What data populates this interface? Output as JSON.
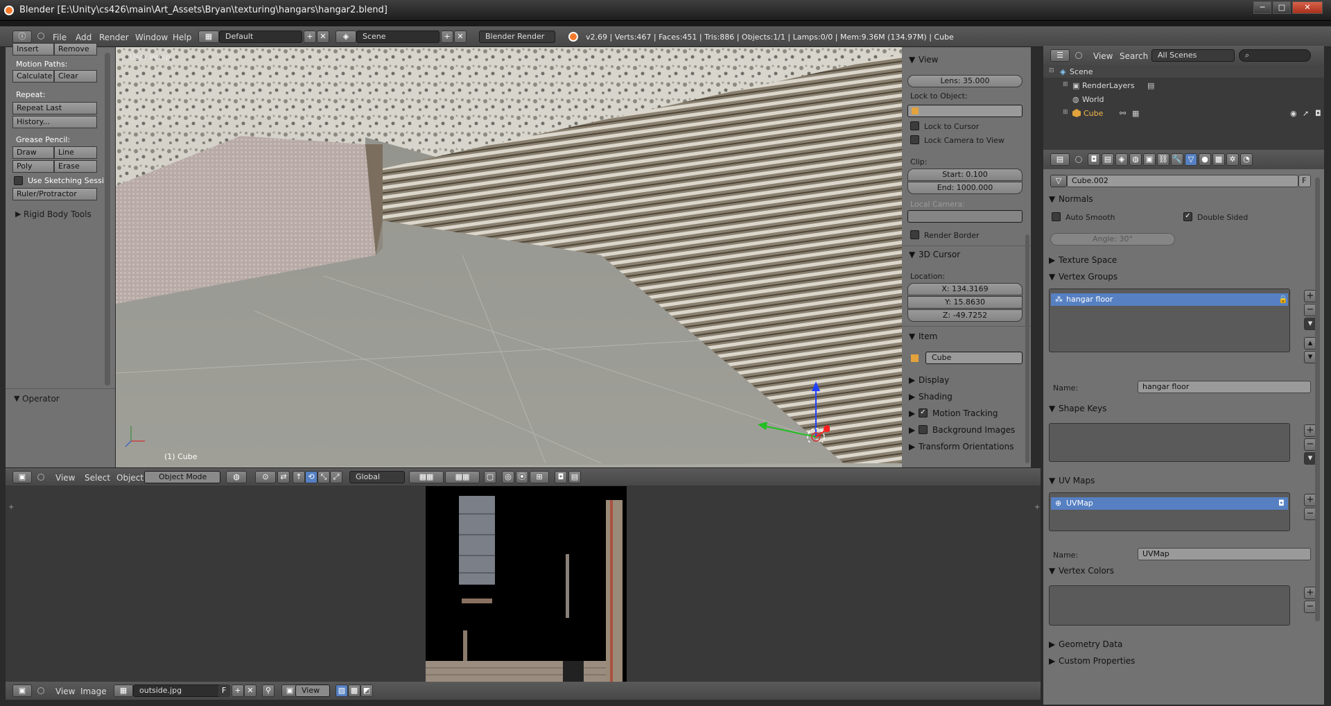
{
  "window": {
    "title": "Blender [E:\\Unity\\cs426\\main\\Art_Assets\\Bryan\\texturing\\hangars\\hangar2.blend]",
    "min": "─",
    "max": "□",
    "close": "✕"
  },
  "info_header": {
    "menus": [
      "File",
      "Add",
      "Render",
      "Window",
      "Help"
    ],
    "screen_layout": "Default",
    "scene": "Scene",
    "render_engine": "Blender Render",
    "stats": "v2.69 | Verts:467 | Faces:451 | Tris:886 | Objects:1/1 | Lamps:0/0 | Mem:9.36M (134.97M) | Cube"
  },
  "tool_shelf": {
    "insert": "Insert",
    "remove": "Remove",
    "motion_paths": "Motion Paths:",
    "calculate": "Calculate",
    "clear": "Clear",
    "repeat": "Repeat:",
    "repeat_last": "Repeat Last",
    "history": "History...",
    "grease_pencil": "Grease Pencil:",
    "draw": "Draw",
    "line": "Line",
    "poly": "Poly",
    "erase": "Erase",
    "use_sketching": "Use Sketching Sessi",
    "ruler": "Ruler/Protractor",
    "rigid_body_tools": "Rigid Body Tools",
    "operator": "Operator"
  },
  "viewport": {
    "view_name": "User Persp",
    "object_label": "(1) Cube"
  },
  "properties_n": {
    "view": "View",
    "lens": "Lens: 35.000",
    "lock_to_object": "Lock to Object:",
    "lock_to_cursor": "Lock to Cursor",
    "lock_camera": "Lock Camera to View",
    "clip": "Clip:",
    "clip_start": "Start: 0.100",
    "clip_end": "End: 1000.000",
    "local_camera": "Local Camera:",
    "render_border": "Render Border",
    "cursor_3d": "3D Cursor",
    "location": "Location:",
    "x": "X: 134.3169",
    "y": "Y: 15.8630",
    "z": "Z: -49.7252",
    "item": "Item",
    "item_name": "Cube",
    "display": "Display",
    "shading": "Shading",
    "motion_tracking": "Motion Tracking",
    "background_images": "Background Images",
    "transform_orientations": "Transform Orientations"
  },
  "view3d_header": {
    "view": "View",
    "select": "Select",
    "object": "Object",
    "mode": "Object Mode",
    "orientation": "Global"
  },
  "image_editor": {
    "view": "View",
    "image": "Image",
    "image_name": "outside.jpg",
    "f": "F",
    "view_mode": "View"
  },
  "outliner": {
    "view": "View",
    "search": "Search",
    "filter": "All Scenes",
    "items": [
      {
        "label": "Scene"
      },
      {
        "label": "RenderLayers"
      },
      {
        "label": "World"
      },
      {
        "label": "Cube"
      }
    ]
  },
  "data_props": {
    "mesh_name": "Cube.002",
    "f": "F",
    "normals": "Normals",
    "auto_smooth": "Auto Smooth",
    "double_sided": "Double Sided",
    "angle": "Angle: 30°",
    "texture_space": "Texture Space",
    "vertex_groups": "Vertex Groups",
    "vgroup_item": "hangar floor",
    "name_label": "Name:",
    "vgroup_name": "hangar floor",
    "shape_keys": "Shape Keys",
    "uv_maps": "UV Maps",
    "uvmap_item": "UVMap",
    "uvmap_name": "UVMap",
    "vertex_colors": "Vertex Colors",
    "geometry_data": "Geometry Data",
    "custom_properties": "Custom Properties"
  },
  "colors": {
    "selection": "#5680c2",
    "panel": "#727272",
    "header": "#4f4f4f",
    "accent_orange": "#f5792a"
  }
}
